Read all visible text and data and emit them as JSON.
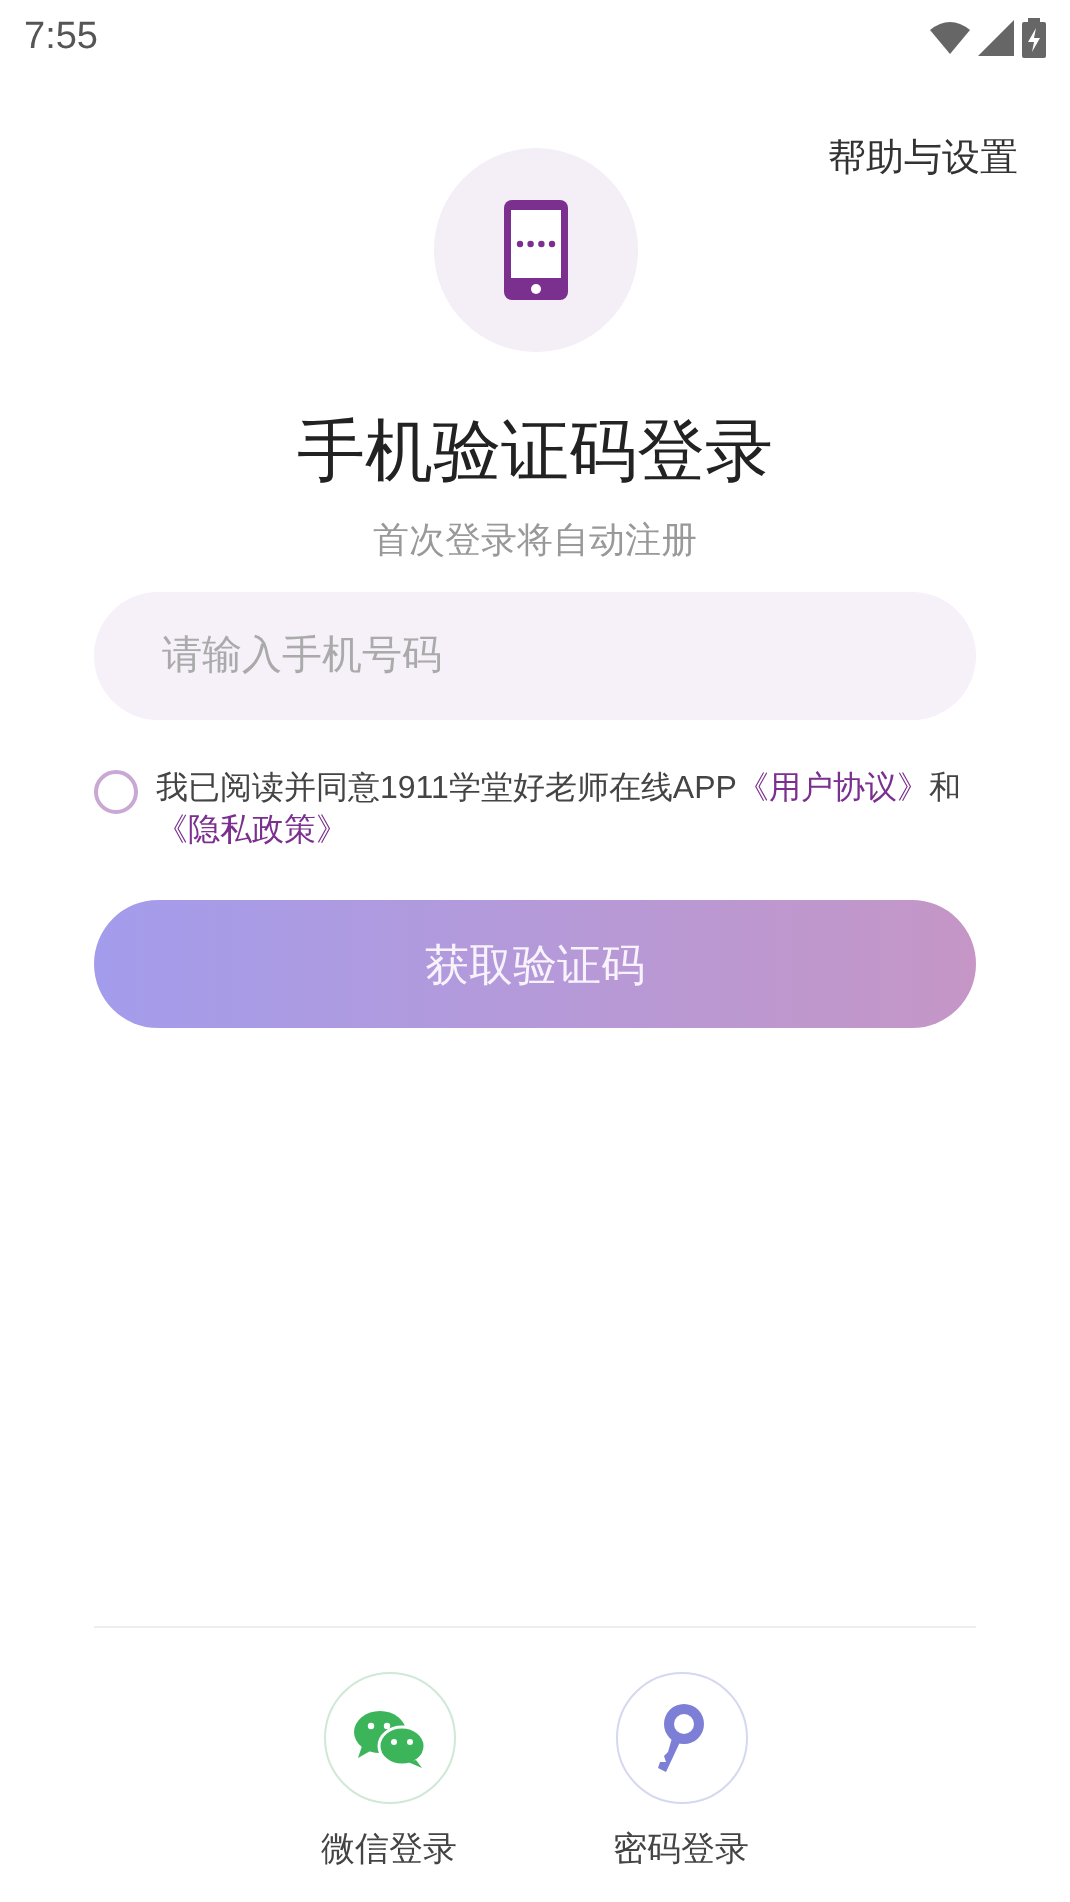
{
  "status_bar": {
    "time": "7:55"
  },
  "help_link": "帮助与设置",
  "title": "手机验证码登录",
  "subtitle": "首次登录将自动注册",
  "phone_field": {
    "placeholder": "请输入手机号码"
  },
  "agreement": {
    "checked": false,
    "parts": [
      {
        "kind": "text",
        "text": "我已阅读并同意1911学堂好老师在线APP"
      },
      {
        "kind": "link",
        "text": "《用户协议》"
      },
      {
        "kind": "text",
        "text": "和"
      },
      {
        "kind": "link",
        "text": "《隐私政策》"
      }
    ]
  },
  "submit_button": {
    "label": "获取验证码",
    "disabled": true
  },
  "alt_logins": [
    {
      "kind": "wechat",
      "label": "微信登录"
    },
    {
      "kind": "password",
      "label": "密码登录"
    }
  ]
}
